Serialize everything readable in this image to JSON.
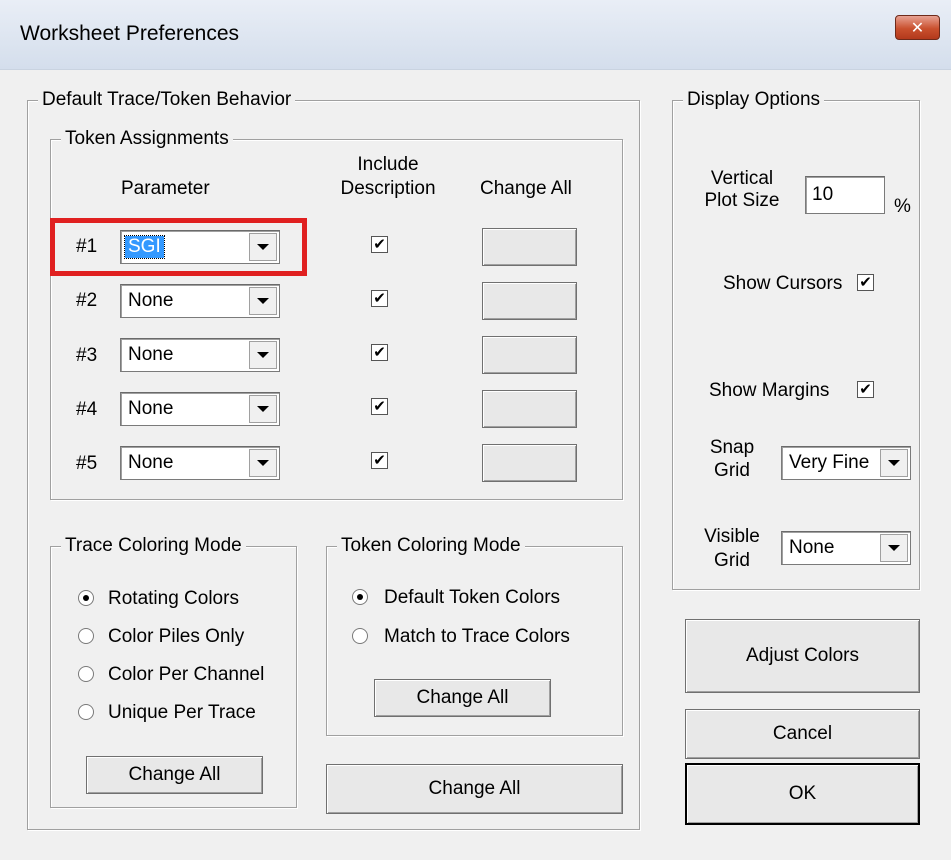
{
  "window": {
    "title": "Worksheet Preferences",
    "close_label": "✕"
  },
  "default_trace": {
    "legend": "Default Trace/Token Behavior",
    "token_assignments": {
      "legend": "Token Assignments",
      "col_parameter": "Parameter",
      "col_include_1": "Include",
      "col_include_2": "Description",
      "col_change_all": "Change All",
      "rows": [
        {
          "label": "#1",
          "value": "SGI",
          "include": "✔"
        },
        {
          "label": "#2",
          "value": "None",
          "include": "✔"
        },
        {
          "label": "#3",
          "value": "None",
          "include": "✔"
        },
        {
          "label": "#4",
          "value": "None",
          "include": "✔"
        },
        {
          "label": "#5",
          "value": "None",
          "include": "✔"
        }
      ]
    },
    "trace_coloring": {
      "legend": "Trace Coloring Mode",
      "options": [
        "Rotating Colors",
        "Color Piles Only",
        "Color Per Channel",
        "Unique Per Trace"
      ],
      "selected": 0,
      "change_all": "Change All"
    },
    "token_coloring": {
      "legend": "Token Coloring Mode",
      "options": [
        "Default Token Colors",
        "Match to Trace Colors"
      ],
      "selected": 0,
      "change_all": "Change All"
    },
    "change_all": "Change All"
  },
  "display_options": {
    "legend": "Display Options",
    "vertical_plot_1": "Vertical",
    "vertical_plot_2": "Plot Size",
    "vertical_plot_value": "10",
    "vertical_plot_unit": "%",
    "show_cursors": "Show Cursors",
    "show_cursors_checked": "✔",
    "show_margins": "Show Margins",
    "show_margins_checked": "✔",
    "snap_grid_1": "Snap",
    "snap_grid_2": "Grid",
    "snap_grid_value": "Very Fine",
    "visible_grid_1": "Visible",
    "visible_grid_2": "Grid",
    "visible_grid_value": "None"
  },
  "buttons": {
    "adjust_colors": "Adjust Colors",
    "cancel": "Cancel",
    "ok": "OK"
  },
  "colors": {
    "highlight": "#e02020",
    "selection": "#3399ff",
    "close": "#c9502e"
  }
}
